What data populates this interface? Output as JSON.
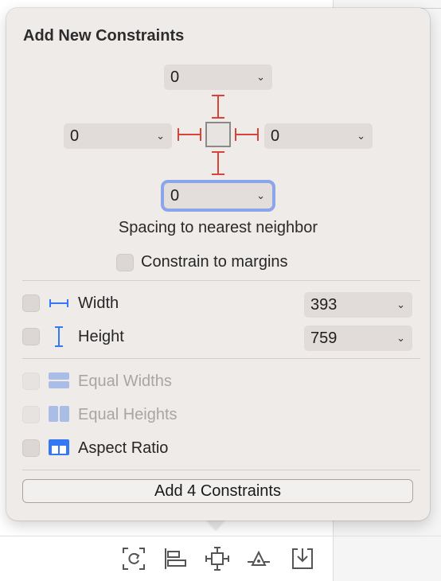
{
  "popover": {
    "title": "Add New Constraints",
    "spacing": {
      "top": "0",
      "left": "0",
      "right": "0",
      "bottom": "0",
      "label": "Spacing to nearest neighbor"
    },
    "constrain_margins": {
      "label": "Constrain to margins",
      "checked": false
    },
    "width": {
      "label": "Width",
      "value": "393",
      "checked": false,
      "icon": "width-icon"
    },
    "height": {
      "label": "Height",
      "value": "759",
      "checked": false,
      "icon": "height-icon"
    },
    "equal_widths": {
      "label": "Equal Widths",
      "enabled": false,
      "icon": "equal-widths-icon"
    },
    "equal_heights": {
      "label": "Equal Heights",
      "enabled": false,
      "icon": "equal-heights-icon"
    },
    "aspect_ratio": {
      "label": "Aspect Ratio",
      "checked": false,
      "icon": "aspect-ratio-icon"
    },
    "add_button": "Add 4 Constraints"
  },
  "toolbar": {
    "icons": [
      "update-frames-icon",
      "align-icon",
      "add-constraints-icon",
      "resolve-issues-icon",
      "embed-in-icon"
    ]
  },
  "colors": {
    "strut_red": "#d9433a",
    "accent_blue": "#3478f6",
    "focus_ring": "#8aa6e8"
  }
}
